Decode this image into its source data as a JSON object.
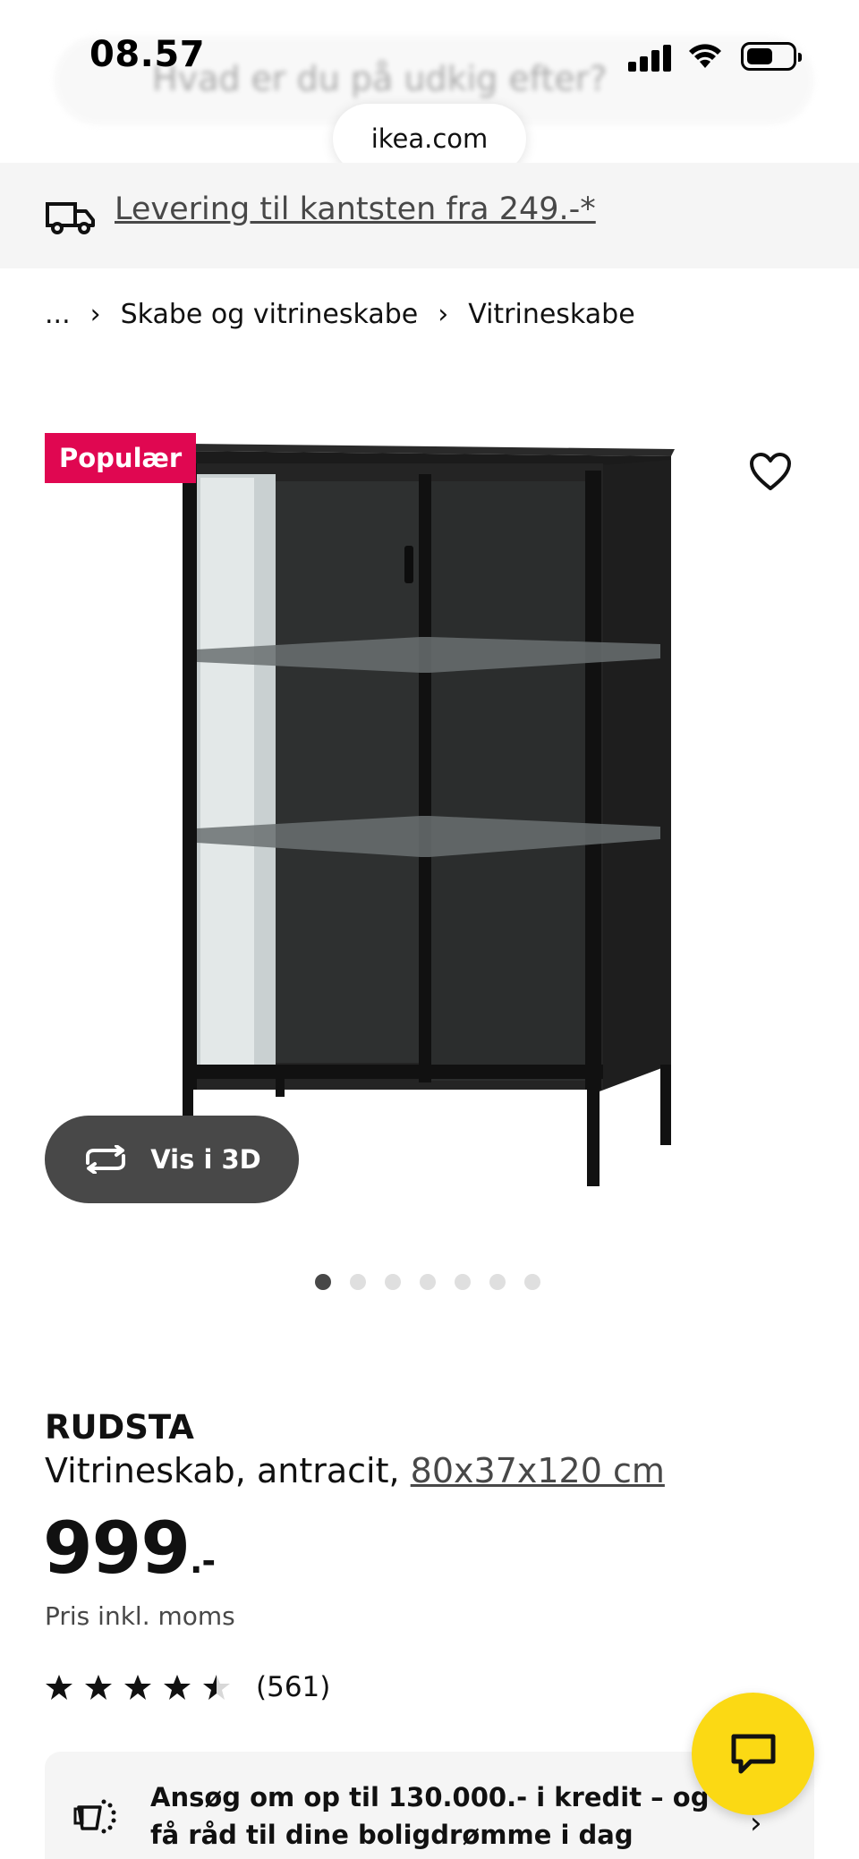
{
  "status_bar": {
    "time": "08.57"
  },
  "ghost_search_placeholder": "Hvad er du på udkig efter?",
  "browser": {
    "url": "ikea.com"
  },
  "delivery_banner": {
    "text": "Levering til kantsten fra 249.-*",
    "icon": "truck-icon"
  },
  "breadcrumb": {
    "ellipsis": "...",
    "items": [
      "Skabe og vitrineskabe",
      "Vitrineskabe"
    ]
  },
  "gallery": {
    "badge": "Populær",
    "view_3d_label": "Vis i 3D",
    "dot_count": 7,
    "active_dot": 0
  },
  "product": {
    "name": "RUDSTA",
    "description": "Vitrineskab, antracit,",
    "dimensions": "80x37x120 cm",
    "price": "999",
    "price_suffix": ".-",
    "price_note": "Pris inkl. moms",
    "rating": 4.5,
    "review_count": "(561)"
  },
  "credit_banner": {
    "text": "Ansøg om op til 130.000.- i kredit – og få råd til dine boligdrømme i dag"
  },
  "colors": {
    "badge": "#e00751",
    "chat": "#fbd914",
    "dark_button": "#484848"
  }
}
